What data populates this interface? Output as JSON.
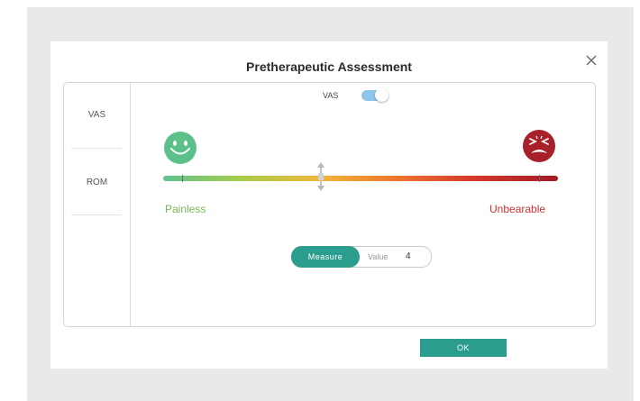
{
  "dialog": {
    "title": "Pretherapeutic Assessment",
    "close_icon": "close-icon"
  },
  "sidebar": {
    "items": [
      {
        "label": "VAS"
      },
      {
        "label": "ROM"
      }
    ]
  },
  "vas_toggle": {
    "label": "VAS",
    "on": true,
    "color": "#8ec6ea"
  },
  "scale": {
    "left_icon": "smiling-face-icon",
    "right_icon": "screaming-face-icon",
    "min_label": "Painless",
    "max_label": "Unbearable",
    "min_color": "#5fc38f",
    "max_color": "#a21a24",
    "value": 4,
    "max": 10
  },
  "measure": {
    "button_label": "Measure",
    "value_label": "Value",
    "value": "4"
  },
  "footer": {
    "ok_label": "OK"
  },
  "colors": {
    "accent": "#2a9d8f",
    "backdrop": "#e9e9ec"
  }
}
